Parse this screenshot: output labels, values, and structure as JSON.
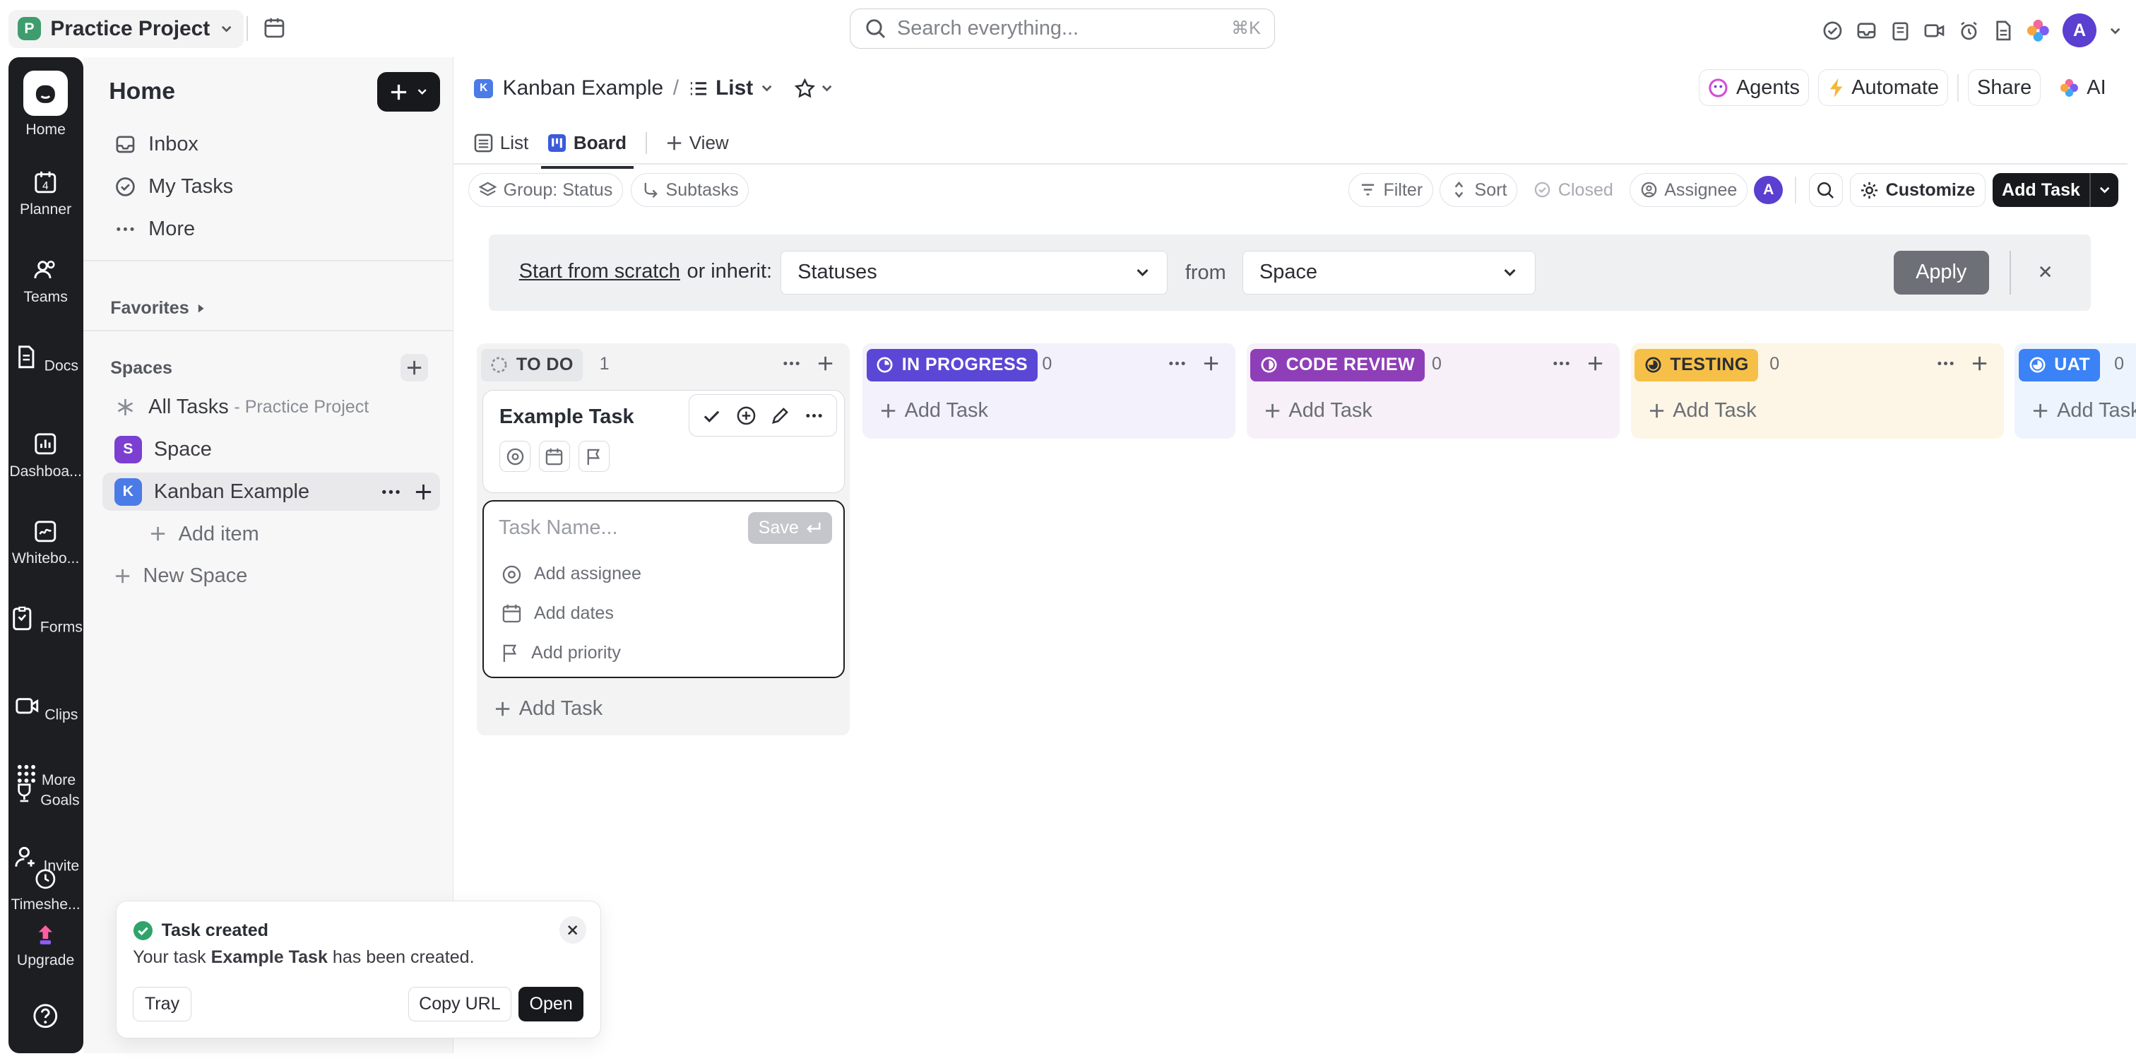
{
  "topbar": {
    "workspace_initial": "P",
    "workspace_name": "Practice Project",
    "search_placeholder": "Search everything...",
    "search_shortcut": "⌘K",
    "avatar_initial": "A"
  },
  "rail": {
    "items": [
      {
        "label": "Home",
        "icon": "home-icon"
      },
      {
        "label": "Planner",
        "icon": "calendar-icon"
      },
      {
        "label": "Teams",
        "icon": "teams-icon"
      },
      {
        "label": "Docs",
        "icon": "docs-icon"
      },
      {
        "label": "Dashboa...",
        "icon": "dashboard-icon"
      },
      {
        "label": "Whitebo...",
        "icon": "whiteboard-icon"
      },
      {
        "label": "Forms",
        "icon": "forms-icon"
      },
      {
        "label": "Clips",
        "icon": "clips-icon"
      },
      {
        "label": "More",
        "icon": "grid-icon"
      },
      {
        "label": "Goals",
        "icon": "goals-icon"
      },
      {
        "label": "Invite",
        "icon": "invite-icon"
      },
      {
        "label": "Timeshe...",
        "icon": "clock-icon"
      },
      {
        "label": "Upgrade",
        "icon": "upgrade-icon"
      }
    ],
    "planner_date": "4",
    "help_icon": "help-icon"
  },
  "sidebar": {
    "title": "Home",
    "nav": [
      {
        "label": "Inbox",
        "icon": "inbox-icon"
      },
      {
        "label": "My Tasks",
        "icon": "check-circle-icon"
      },
      {
        "label": "More",
        "icon": "more-dots-icon"
      }
    ],
    "favorites_label": "Favorites",
    "spaces_label": "Spaces",
    "all_tasks_label": "All Tasks",
    "all_tasks_sub": "- Practice Project",
    "spaces": [
      {
        "initial": "S",
        "label": "Space",
        "color": "#7b3fd2"
      },
      {
        "initial": "K",
        "label": "Kanban Example",
        "color": "#4a7be7"
      }
    ],
    "add_item_label": "Add item",
    "new_space_label": "New Space"
  },
  "main": {
    "breadcrumb_initial": "K",
    "breadcrumb_space": "Kanban Example",
    "breadcrumb_sep": "/",
    "breadcrumb_view": "List",
    "agents_label": "Agents",
    "automate_label": "Automate",
    "share_label": "Share",
    "ai_label": "AI",
    "tabs": [
      {
        "label": "List"
      },
      {
        "label": "Board"
      },
      {
        "label": "View"
      }
    ],
    "toolbar": {
      "group_label": "Group: Status",
      "subtasks_label": "Subtasks",
      "filter_label": "Filter",
      "sort_label": "Sort",
      "closed_label": "Closed",
      "assignee_label": "Assignee",
      "assignee_initial": "A",
      "customize_label": "Customize",
      "add_task_label": "Add Task"
    },
    "inherit": {
      "link_text": "Start from scratch",
      "rest_text": "or inherit:",
      "statuses_value": "Statuses",
      "from_label": "from",
      "space_value": "Space",
      "apply_label": "Apply"
    },
    "columns": [
      {
        "name": "TO DO",
        "count": "1",
        "color": "#e6e7ea",
        "text": "#3a3c42",
        "bg": "#f3f3f4"
      },
      {
        "name": "IN PROGRESS",
        "count": "0",
        "color": "#5b47d6",
        "text": "#ffffff",
        "bg": "#f3f1fb"
      },
      {
        "name": "CODE REVIEW",
        "count": "0",
        "color": "#8e3fb7",
        "text": "#ffffff",
        "bg": "#f7f0f9"
      },
      {
        "name": "TESTING",
        "count": "0",
        "color": "#f6c048",
        "text": "#2b2d33",
        "bg": "#fdf5e5"
      },
      {
        "name": "UAT",
        "count": "0",
        "color": "#3b82f6",
        "text": "#ffffff",
        "bg": "#eef4fe"
      }
    ],
    "add_task_col": "Add Task",
    "example_task": "Example Task",
    "new_task": {
      "placeholder": "Task Name...",
      "save_label": "Save",
      "assignee_label": "Add assignee",
      "dates_label": "Add dates",
      "priority_label": "Add priority"
    }
  },
  "toast": {
    "title": "Task created",
    "msg_prefix": "Your task",
    "msg_task": "Example Task",
    "msg_suffix": "has been created.",
    "tray_label": "Tray",
    "copy_url_label": "Copy URL",
    "open_label": "Open"
  }
}
